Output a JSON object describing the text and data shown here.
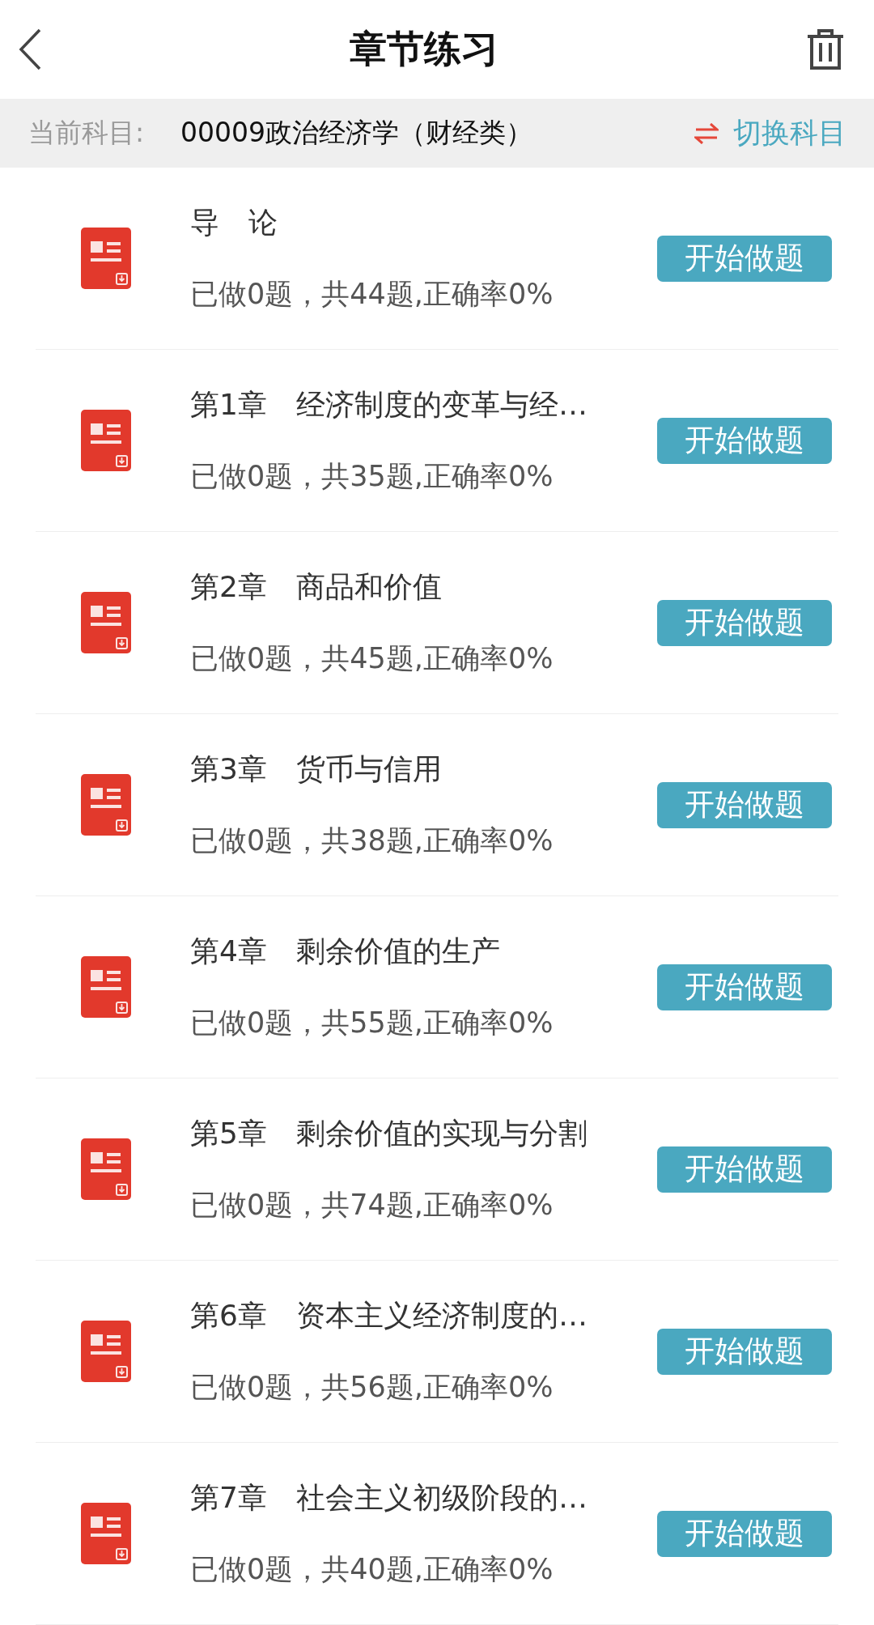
{
  "header": {
    "title": "章节练习"
  },
  "subject_bar": {
    "label": "当前科目:",
    "subject": "00009政治经济学（财经类）",
    "switch_label": "切换科目"
  },
  "chapters": [
    {
      "title": "导　论",
      "stats": "已做0题，共44题,正确率0%",
      "button": "开始做题"
    },
    {
      "title": "第1章　经济制度的变革与经…",
      "stats": "已做0题，共35题,正确率0%",
      "button": "开始做题"
    },
    {
      "title": "第2章　商品和价值",
      "stats": "已做0题，共45题,正确率0%",
      "button": "开始做题"
    },
    {
      "title": "第3章　货币与信用",
      "stats": "已做0题，共38题,正确率0%",
      "button": "开始做题"
    },
    {
      "title": "第4章　剩余价值的生产",
      "stats": "已做0题，共55题,正确率0%",
      "button": "开始做题"
    },
    {
      "title": "第5章　剩余价值的实现与分割",
      "stats": "已做0题，共74题,正确率0%",
      "button": "开始做题"
    },
    {
      "title": "第6章　资本主义经济制度的…",
      "stats": "已做0题，共56题,正确率0%",
      "button": "开始做题"
    },
    {
      "title": "第7章　社会主义初级阶段的…",
      "stats": "已做0题，共40题,正确率0%",
      "button": "开始做题"
    }
  ]
}
